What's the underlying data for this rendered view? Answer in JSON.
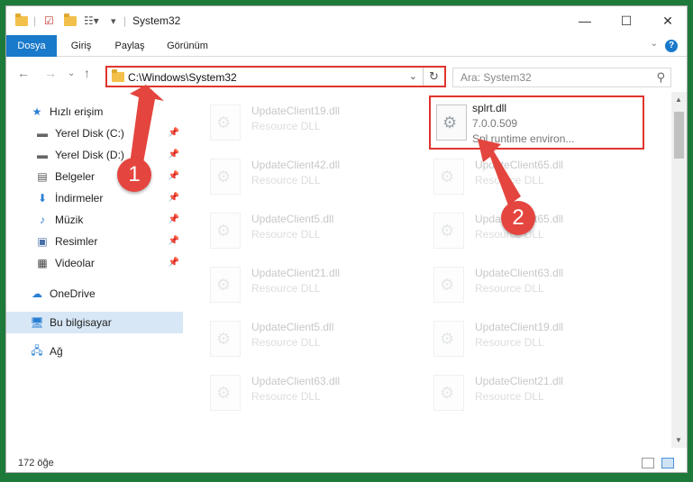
{
  "window": {
    "title": "System32"
  },
  "ribbon": {
    "tabs": [
      {
        "label": "Dosya",
        "active": true
      },
      {
        "label": "Giriş",
        "active": false
      },
      {
        "label": "Paylaş",
        "active": false
      },
      {
        "label": "Görünüm",
        "active": false
      }
    ],
    "help": "?"
  },
  "address": {
    "path": "C:\\Windows\\System32"
  },
  "search": {
    "placeholder": "Ara: System32"
  },
  "sidebar": {
    "items": [
      {
        "label": "Hızlı erişim",
        "icon": "star-icon",
        "pinned": false
      },
      {
        "label": "Yerel Disk (C:)",
        "icon": "drive-icon",
        "pinned": true
      },
      {
        "label": "Yerel Disk (D:)",
        "icon": "drive-icon",
        "pinned": true
      },
      {
        "label": "Belgeler",
        "icon": "document-icon",
        "pinned": true
      },
      {
        "label": "İndirmeler",
        "icon": "download-icon",
        "pinned": true
      },
      {
        "label": "Müzik",
        "icon": "music-icon",
        "pinned": true
      },
      {
        "label": "Resimler",
        "icon": "pictures-icon",
        "pinned": true
      },
      {
        "label": "Videolar",
        "icon": "video-icon",
        "pinned": true
      },
      {
        "label": "OneDrive",
        "icon": "cloud-icon",
        "pinned": false
      },
      {
        "label": "Bu bilgisayar",
        "icon": "computer-icon",
        "pinned": false,
        "selected": true
      },
      {
        "label": "Ağ",
        "icon": "network-icon",
        "pinned": false
      }
    ]
  },
  "files": [
    {
      "name": "UpdateClient19.dll",
      "type": "Resource DLL"
    },
    {
      "name": "splrt.dll",
      "version": "7.0.0.509",
      "description": "Spl runtime environ...",
      "highlighted": true
    },
    {
      "name": "UpdateClient42.dll",
      "type": "Resource DLL"
    },
    {
      "name": "UpdateClient65.dll",
      "type": "Resource DLL"
    },
    {
      "name": "UpdateClient5.dll",
      "type": "Resource DLL"
    },
    {
      "name": "UpdateClient65.dll",
      "type": "Resource DLL"
    },
    {
      "name": "UpdateClient21.dll",
      "type": "Resource DLL"
    },
    {
      "name": "UpdateClient63.dll",
      "type": "Resource DLL"
    },
    {
      "name": "UpdateClient5.dll",
      "type": "Resource DLL"
    },
    {
      "name": "UpdateClient19.dll",
      "type": "Resource DLL"
    },
    {
      "name": "UpdateClient63.dll",
      "type": "Resource DLL"
    },
    {
      "name": "UpdateClient21.dll",
      "type": "Resource DLL"
    }
  ],
  "status": {
    "count": "172 öğe"
  },
  "callouts": [
    {
      "number": "1"
    },
    {
      "number": "2"
    }
  ],
  "colors": {
    "accent": "#1979ca",
    "highlight": "#e0342f",
    "callout": "#e4453e"
  }
}
